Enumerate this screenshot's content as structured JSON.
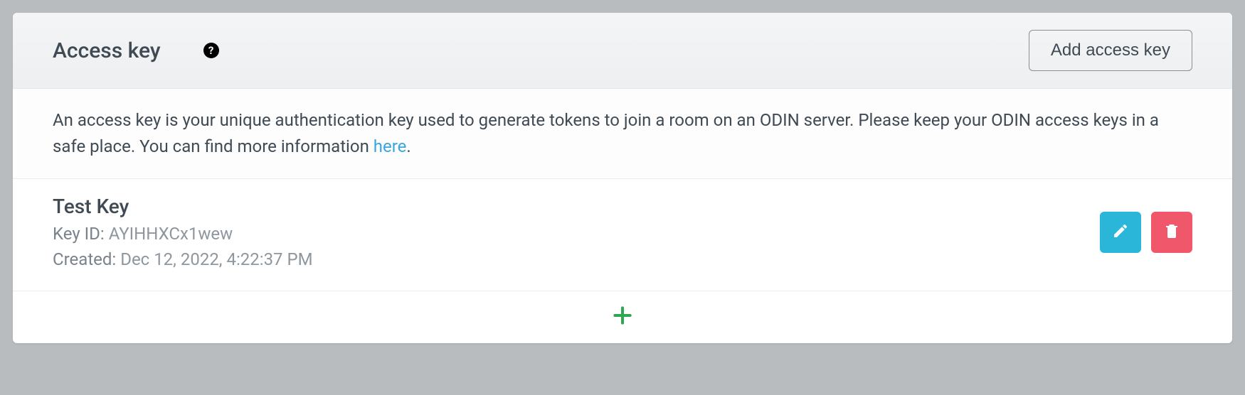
{
  "header": {
    "title": "Access key",
    "add_button": "Add access key"
  },
  "description": {
    "text_before": "An access key is your unique authentication key used to generate tokens to join a room on an ODIN server. Please keep your ODIN access keys in a safe place. You can find more information ",
    "link_text": "here",
    "text_after": "."
  },
  "keys": [
    {
      "name": "Test Key",
      "key_id_label": "Key ID:",
      "key_id_value": "AYIHHXCx1wew",
      "created_label": "Created:",
      "created_value": "Dec 12, 2022, 4:22:37 PM"
    }
  ]
}
